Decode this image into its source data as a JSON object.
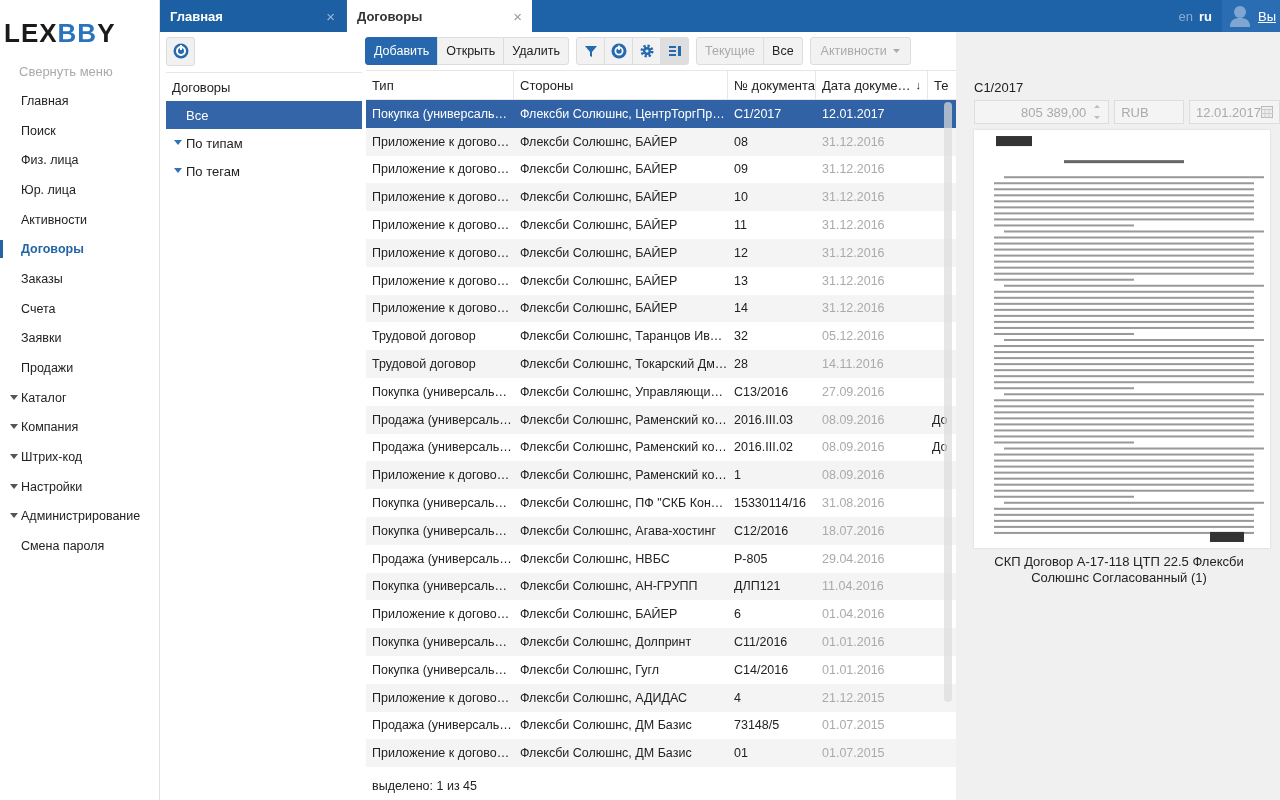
{
  "logo": {
    "parts": [
      {
        "text": "LEX",
        "accent": false
      },
      {
        "text": "BB",
        "accent": true
      },
      {
        "text": "Y",
        "accent": false
      }
    ]
  },
  "sidebar": {
    "collapse_label": "Свернуть меню",
    "items": [
      {
        "label": "Главная",
        "selected": false,
        "kind": "link"
      },
      {
        "label": "Поиск",
        "selected": false,
        "kind": "link"
      },
      {
        "label": "Физ. лица",
        "selected": false,
        "kind": "link"
      },
      {
        "label": "Юр. лица",
        "selected": false,
        "kind": "link"
      },
      {
        "label": "Активности",
        "selected": false,
        "kind": "link"
      },
      {
        "label": "Договоры",
        "selected": true,
        "kind": "link"
      },
      {
        "label": "Заказы",
        "selected": false,
        "kind": "link"
      },
      {
        "label": "Счета",
        "selected": false,
        "kind": "link"
      },
      {
        "label": "Заявки",
        "selected": false,
        "kind": "link"
      },
      {
        "label": "Продажи",
        "selected": false,
        "kind": "link"
      },
      {
        "label": "Каталог",
        "selected": false,
        "kind": "group"
      },
      {
        "label": "Компания",
        "selected": false,
        "kind": "group"
      },
      {
        "label": "Штрих-код",
        "selected": false,
        "kind": "group"
      },
      {
        "label": "Настройки",
        "selected": false,
        "kind": "group"
      },
      {
        "label": "Администрирование",
        "selected": false,
        "kind": "group"
      },
      {
        "label": "Смена пароля",
        "selected": false,
        "kind": "link"
      }
    ]
  },
  "tabs": [
    {
      "label": "Главная",
      "selected": false,
      "close": "×"
    },
    {
      "label": "Договоры",
      "selected": true,
      "close": "×"
    }
  ],
  "languages": [
    {
      "label": "en",
      "selected": false
    },
    {
      "label": "ru",
      "selected": true
    }
  ],
  "logout_link": "Вы",
  "tree": {
    "header": "Договоры",
    "items": [
      {
        "label": "Все",
        "selected": true,
        "expandable": false
      },
      {
        "label": "По типам",
        "selected": false,
        "expandable": true
      },
      {
        "label": "По тегам",
        "selected": false,
        "expandable": true
      }
    ]
  },
  "toolbar": {
    "actions": [
      {
        "label": "Добавить",
        "primary": true
      },
      {
        "label": "Открыть",
        "primary": false
      },
      {
        "label": "Удалить",
        "primary": false
      }
    ],
    "icon_buttons": [
      {
        "kind": "filter",
        "selected": false
      },
      {
        "kind": "refresh",
        "selected": false
      },
      {
        "kind": "settings",
        "selected": false
      },
      {
        "kind": "columns",
        "selected": true
      }
    ],
    "scope": [
      {
        "label": "Текущие",
        "disabled": true
      },
      {
        "label": "Все",
        "disabled": false
      }
    ],
    "dropdown": {
      "label": "Активности",
      "disabled": true
    }
  },
  "table": {
    "columns": [
      "Тип",
      "Стороны",
      "№ документа",
      "Дата докуме…",
      "Те"
    ],
    "sort_icon": "↓",
    "rows": [
      {
        "selected": true,
        "cells": [
          "Покупка (универсаль…",
          "Флексби Солюшнс, ЦентрТоргПр…",
          "С1/2017",
          "12.01.2017",
          ""
        ]
      },
      {
        "selected": false,
        "cells": [
          "Приложение к догово…",
          "Флексби Солюшнс, БАЙЕР",
          "08",
          "31.12.2016",
          ""
        ]
      },
      {
        "selected": false,
        "cells": [
          "Приложение к догово…",
          "Флексби Солюшнс, БАЙЕР",
          "09",
          "31.12.2016",
          ""
        ]
      },
      {
        "selected": false,
        "cells": [
          "Приложение к догово…",
          "Флексби Солюшнс, БАЙЕР",
          "10",
          "31.12.2016",
          ""
        ]
      },
      {
        "selected": false,
        "cells": [
          "Приложение к догово…",
          "Флексби Солюшнс, БАЙЕР",
          "11",
          "31.12.2016",
          ""
        ]
      },
      {
        "selected": false,
        "cells": [
          "Приложение к догово…",
          "Флексби Солюшнс, БАЙЕР",
          "12",
          "31.12.2016",
          ""
        ]
      },
      {
        "selected": false,
        "cells": [
          "Приложение к догово…",
          "Флексби Солюшнс, БАЙЕР",
          "13",
          "31.12.2016",
          ""
        ]
      },
      {
        "selected": false,
        "cells": [
          "Приложение к догово…",
          "Флексби Солюшнс, БАЙЕР",
          "14",
          "31.12.2016",
          ""
        ]
      },
      {
        "selected": false,
        "cells": [
          "Трудовой договор",
          "Флексби Солюшнс, Таранцов Ив…",
          "32",
          "05.12.2016",
          ""
        ]
      },
      {
        "selected": false,
        "cells": [
          "Трудовой договор",
          "Флексби Солюшнс, Токарский Дм…",
          "28",
          "14.11.2016",
          ""
        ]
      },
      {
        "selected": false,
        "cells": [
          "Покупка (универсаль…",
          "Флексби Солюшнс, Управляющи…",
          "С13/2016",
          "27.09.2016",
          ""
        ]
      },
      {
        "selected": false,
        "cells": [
          "Продажа (универсаль…",
          "Флексби Солюшнс, Раменский ко…",
          "2016.III.03",
          "08.09.2016",
          "До"
        ]
      },
      {
        "selected": false,
        "cells": [
          "Продажа (универсаль…",
          "Флексби Солюшнс, Раменский ко…",
          "2016.III.02",
          "08.09.2016",
          "До"
        ]
      },
      {
        "selected": false,
        "cells": [
          "Приложение к догово…",
          "Флексби Солюшнс, Раменский ко…",
          "1",
          "08.09.2016",
          ""
        ]
      },
      {
        "selected": false,
        "cells": [
          "Покупка (универсаль…",
          "Флексби Солюшнс, ПФ \"СКБ Кон…",
          "15330114/16",
          "31.08.2016",
          ""
        ]
      },
      {
        "selected": false,
        "cells": [
          "Покупка (универсаль…",
          "Флексби Солюшнс, Агава-хостинг",
          "С12/2016",
          "18.07.2016",
          ""
        ]
      },
      {
        "selected": false,
        "cells": [
          "Продажа (универсаль…",
          "Флексби Солюшнс, НВБС",
          "Р-805",
          "29.04.2016",
          ""
        ]
      },
      {
        "selected": false,
        "cells": [
          "Покупка (универсаль…",
          "Флексби Солюшнс, АН-ГРУПП",
          "ДЛП121",
          "11.04.2016",
          ""
        ]
      },
      {
        "selected": false,
        "cells": [
          "Приложение к догово…",
          "Флексби Солюшнс, БАЙЕР",
          "6",
          "01.04.2016",
          ""
        ]
      },
      {
        "selected": false,
        "cells": [
          "Покупка (универсаль…",
          "Флексби Солюшнс, Долпринт",
          "С11/2016",
          "01.01.2016",
          ""
        ]
      },
      {
        "selected": false,
        "cells": [
          "Покупка (универсаль…",
          "Флексби Солюшнс, Гугл",
          "С14/2016",
          "01.01.2016",
          ""
        ]
      },
      {
        "selected": false,
        "cells": [
          "Приложение к догово…",
          "Флексби Солюшнс, АДИДАС",
          "4",
          "21.12.2015",
          ""
        ]
      },
      {
        "selected": false,
        "cells": [
          "Продажа (универсаль…",
          "Флексби Солюшнс, ДМ Базис",
          "73148/5",
          "01.07.2015",
          ""
        ]
      },
      {
        "selected": false,
        "cells": [
          "Приложение к догово…",
          "Флексби Солюшнс, ДМ Базис",
          "01",
          "01.07.2015",
          ""
        ]
      }
    ]
  },
  "status": "выделено: 1 из 45",
  "preview": {
    "number": "С1/2017",
    "amount": "805 389,00",
    "currency": "RUB",
    "date": "12.01.2017",
    "caption": "СКП Договор А-17-118 ЦТП 22.5 Флексби Солюшнс Согласованный (1)"
  }
}
